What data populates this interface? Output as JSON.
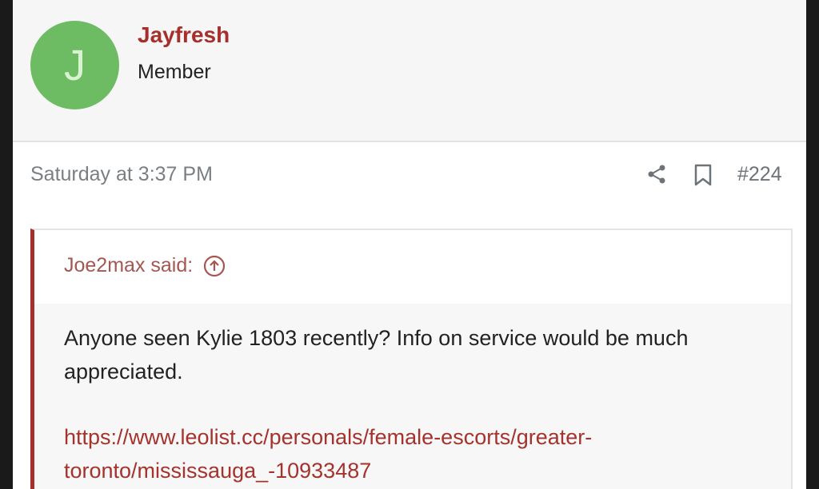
{
  "user": {
    "avatar_letter": "J",
    "avatar_color": "#6dbb63",
    "name": "Jayfresh",
    "role": "Member"
  },
  "post": {
    "timestamp": "Saturday at 3:37 PM",
    "number": "#224",
    "icons": [
      "share-icon",
      "bookmark-icon"
    ]
  },
  "quote": {
    "author": "Joe2max said:",
    "text": "Anyone seen Kylie 1803 recently? Info on service would be much appreciated.",
    "link_line1": "https://www.leolist.cc/personals/female-escorts/greater-",
    "link_line2": "toronto/mississauga_-10933487"
  },
  "colors": {
    "accent": "#a62e2b",
    "muted": "#7a7f84"
  }
}
